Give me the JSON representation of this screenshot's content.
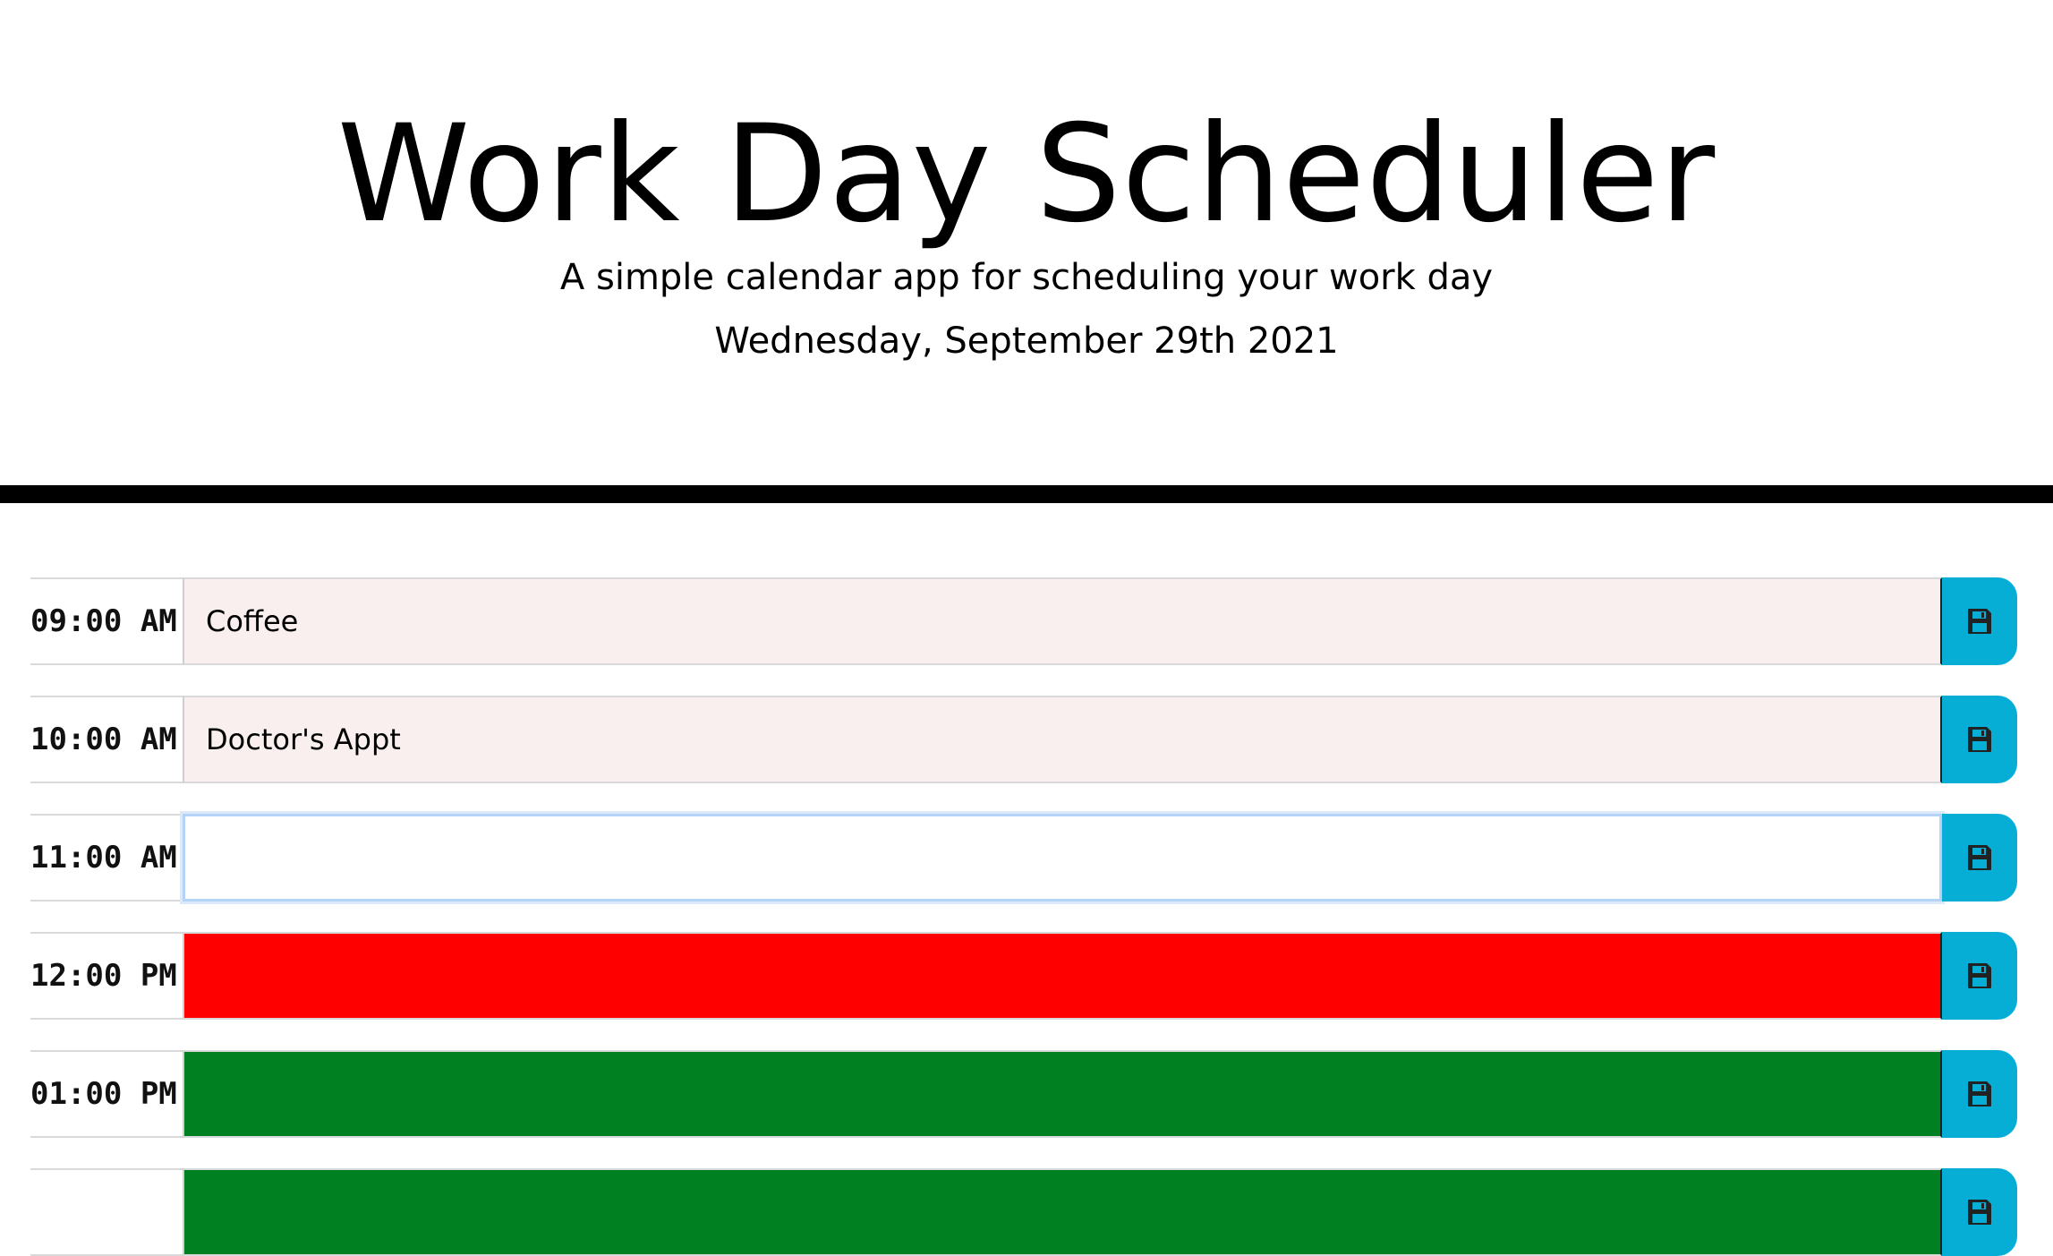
{
  "header": {
    "title": "Work Day Scheduler",
    "subtitle": "A simple calendar app for scheduling your work day",
    "current_day": "Wednesday, September 29th 2021"
  },
  "colors": {
    "past": "#f8efee",
    "present": "#ff0000",
    "future": "#008020",
    "save_button": "#06aed5"
  },
  "time_blocks": [
    {
      "hour": "09:00 AM",
      "text": "Coffee",
      "state": "past",
      "icon": "save-icon"
    },
    {
      "hour": "10:00 AM",
      "text": "Doctor's Appt",
      "state": "past",
      "icon": "save-icon"
    },
    {
      "hour": "11:00 AM",
      "text": "",
      "state": "focused",
      "icon": "save-icon"
    },
    {
      "hour": "12:00 PM",
      "text": "",
      "state": "present",
      "icon": "save-icon"
    },
    {
      "hour": "01:00 PM",
      "text": "",
      "state": "future",
      "icon": "save-icon"
    },
    {
      "hour": "",
      "text": "",
      "state": "future",
      "icon": "save-icon"
    }
  ]
}
